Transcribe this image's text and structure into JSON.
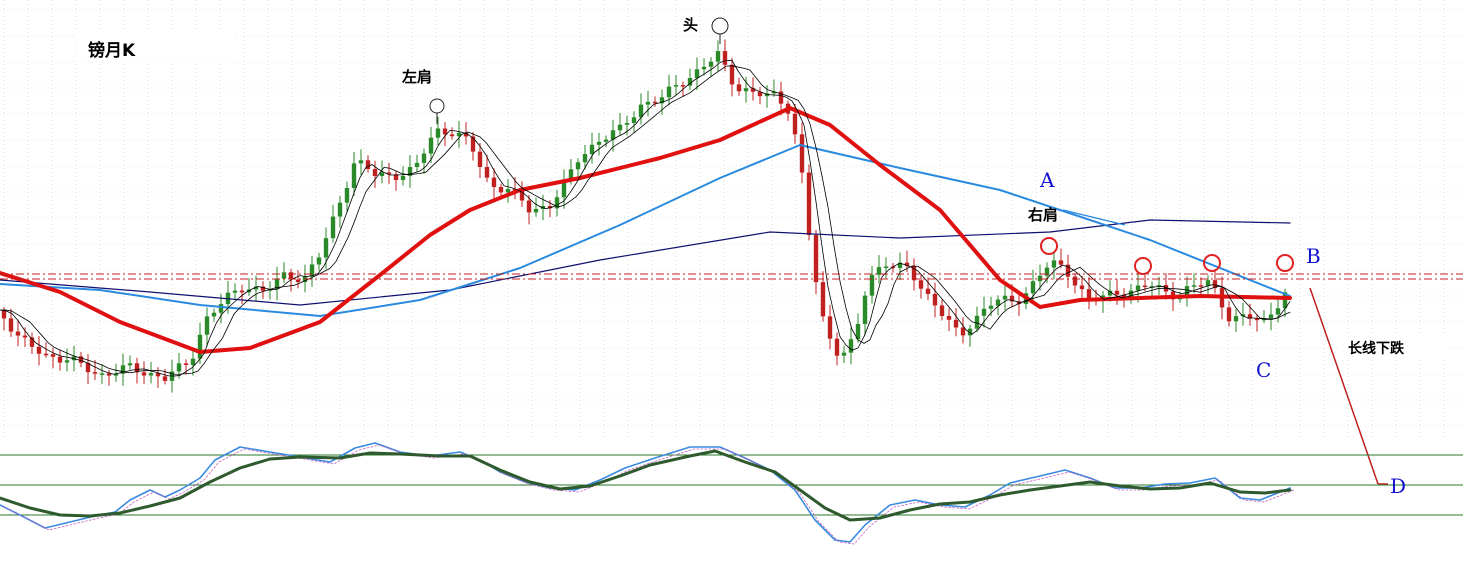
{
  "chart_data": {
    "type": "candlestick",
    "title": "镑月K",
    "annotations": {
      "left_shoulder": "左肩",
      "head": "头",
      "right_shoulder": "右肩",
      "point_a": "A",
      "point_b": "B",
      "point_c": "C",
      "point_d": "D",
      "long_term_down": "长线下跌"
    },
    "colors": {
      "bull": "#2a8a2a",
      "bear": "#c02020",
      "ma_short": "#000000",
      "ma_mid": "#e01010",
      "ma_long": "#2a8adf",
      "ma_longest": "#101070",
      "neckline": "#c02020",
      "osc_fast": "#3a8ae0",
      "osc_slow": "#2e5a2e",
      "osc_level": "#2a7a2a",
      "marker_circle_dark": "#222222",
      "marker_circle_red": "#e02020",
      "grid": "#c8c8c8"
    },
    "grid": true,
    "legend": "none"
  }
}
